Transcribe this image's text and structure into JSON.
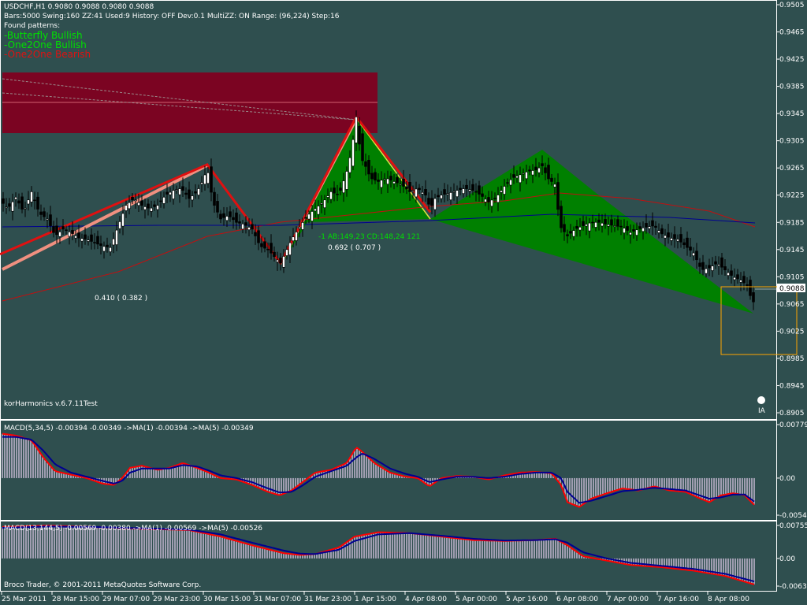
{
  "header": {
    "symbol_line": "USDCHF,H1  0.9080 0.9088 0.9080 0.9088",
    "params_line": "Bars:5000  Swing:160  ZZ:41  Used:9  History: OFF Dev:0.1  MultiZZ: ON  Range: (96,224)  Step:16",
    "found_label": "Found patterns:",
    "patterns": [
      {
        "text": "-Butterfly Bullish",
        "color": "#00e000"
      },
      {
        "text": "-One2One Bullish",
        "color": "#00e000"
      },
      {
        "text": "-One2One Bearish",
        "color": "#e01010"
      }
    ]
  },
  "footer": {
    "indicator_name": "korHarmonics v.6.7.11Test",
    "copyright": "Broco Trader, © 2001-2011 MetaQuotes Software Corp."
  },
  "colors": {
    "background": "#2F4F4F",
    "candle": "#000000",
    "green_pattern": "#008000",
    "red_zone": "#800020",
    "red_line": "#e01010",
    "pink_line": "#f09080",
    "macd_hist": "#dcc8e6",
    "signal_red": "#ff0000",
    "signal_blue": "#000090"
  },
  "chart_data": [
    {
      "type": "candlestick",
      "name": "USDCHF,H1",
      "price_axis_ticks": [
        "0.9505",
        "0.9465",
        "0.9425",
        "0.9385",
        "0.9345",
        "0.9305",
        "0.9265",
        "0.9225",
        "0.9185",
        "0.9145",
        "0.9105",
        "0.9065",
        "0.9025",
        "0.8985",
        "0.8945",
        "0.8905"
      ],
      "current_price": "0.9088",
      "time_axis_ticks": [
        "25 Mar 2011",
        "28 Mar 15:00",
        "29 Mar 07:00",
        "29 Mar 23:00",
        "30 Mar 15:00",
        "31 Mar 07:00",
        "31 Mar 23:00",
        "1 Apr 15:00",
        "4 Apr 08:00",
        "5 Apr 00:00",
        "5 Apr 16:00",
        "6 Apr 08:00",
        "7 Apr 00:00",
        "7 Apr 16:00",
        "8 Apr 08:00"
      ],
      "close_path": [
        [
          0,
          0.9218
        ],
        [
          10,
          0.9205
        ],
        [
          20,
          0.9222
        ],
        [
          30,
          0.92
        ],
        [
          40,
          0.923
        ],
        [
          50,
          0.9198
        ],
        [
          60,
          0.919
        ],
        [
          70,
          0.9165
        ],
        [
          80,
          0.9175
        ],
        [
          90,
          0.917
        ],
        [
          100,
          0.9162
        ],
        [
          110,
          0.916
        ],
        [
          120,
          0.9155
        ],
        [
          130,
          0.915
        ],
        [
          140,
          0.9148
        ],
        [
          150,
          0.918
        ],
        [
          160,
          0.921
        ],
        [
          170,
          0.922
        ],
        [
          180,
          0.921
        ],
        [
          190,
          0.9205
        ],
        [
          200,
          0.921
        ],
        [
          210,
          0.9225
        ],
        [
          220,
          0.9232
        ],
        [
          230,
          0.9235
        ],
        [
          240,
          0.922
        ],
        [
          250,
          0.923
        ],
        [
          258,
          0.9248
        ],
        [
          263,
          0.9265
        ],
        [
          270,
          0.9215
        ],
        [
          280,
          0.919
        ],
        [
          290,
          0.9195
        ],
        [
          300,
          0.9185
        ],
        [
          310,
          0.9182
        ],
        [
          320,
          0.9175
        ],
        [
          330,
          0.915
        ],
        [
          340,
          0.9145
        ],
        [
          350,
          0.9132
        ],
        [
          356,
          0.9125
        ],
        [
          362,
          0.914
        ],
        [
          370,
          0.916
        ],
        [
          380,
          0.9178
        ],
        [
          390,
          0.9195
        ],
        [
          400,
          0.9205
        ],
        [
          410,
          0.9215
        ],
        [
          420,
          0.923
        ],
        [
          430,
          0.9225
        ],
        [
          440,
          0.926
        ],
        [
          446,
          0.929
        ],
        [
          452,
          0.934
        ],
        [
          458,
          0.928
        ],
        [
          465,
          0.9265
        ],
        [
          470,
          0.925
        ],
        [
          480,
          0.9245
        ],
        [
          490,
          0.925
        ],
        [
          500,
          0.9245
        ],
        [
          510,
          0.924
        ],
        [
          520,
          0.923
        ],
        [
          530,
          0.9235
        ],
        [
          540,
          0.9225
        ],
        [
          546,
          0.9205
        ],
        [
          552,
          0.922
        ],
        [
          560,
          0.9225
        ],
        [
          570,
          0.9228
        ],
        [
          580,
          0.9232
        ],
        [
          590,
          0.9235
        ],
        [
          600,
          0.9232
        ],
        [
          610,
          0.9225
        ],
        [
          620,
          0.9215
        ],
        [
          630,
          0.9222
        ],
        [
          640,
          0.9238
        ],
        [
          650,
          0.925
        ],
        [
          660,
          0.9255
        ],
        [
          670,
          0.926
        ],
        [
          680,
          0.9262
        ],
        [
          688,
          0.9268
        ],
        [
          695,
          0.925
        ],
        [
          705,
          0.924
        ],
        [
          710,
          0.918
        ],
        [
          720,
          0.9165
        ],
        [
          730,
          0.9175
        ],
        [
          740,
          0.918
        ],
        [
          750,
          0.9185
        ],
        [
          760,
          0.9185
        ],
        [
          770,
          0.9182
        ],
        [
          780,
          0.918
        ],
        [
          790,
          0.9178
        ],
        [
          800,
          0.917
        ],
        [
          810,
          0.9175
        ],
        [
          820,
          0.9178
        ],
        [
          830,
          0.918
        ],
        [
          840,
          0.9168
        ],
        [
          850,
          0.9162
        ],
        [
          860,
          0.916
        ],
        [
          870,
          0.915
        ],
        [
          880,
          0.914
        ],
        [
          890,
          0.9115
        ],
        [
          900,
          0.9118
        ],
        [
          910,
          0.9125
        ],
        [
          920,
          0.9115
        ],
        [
          930,
          0.9105
        ],
        [
          940,
          0.91
        ],
        [
          950,
          0.909
        ],
        [
          955,
          0.9058
        ],
        [
          958,
          0.9088
        ]
      ],
      "zigzag": [
        [
          0,
          0.9138
        ],
        [
          263,
          0.927
        ],
        [
          356,
          0.9125
        ],
        [
          452,
          0.934
        ],
        [
          546,
          0.92
        ]
      ],
      "pattern_labels": [
        {
          "text": "-1   AB:149,23 CD:148,24   121",
          "color": "#00e000"
        },
        {
          "text": "0.692 ( 0.707 )",
          "color": "#ffffff"
        },
        {
          "text": "0.410 ( 0.382 )",
          "color": "#ffffff"
        }
      ]
    },
    {
      "type": "macd",
      "name": "MACD(5,34,5)",
      "label": "MACD(5,34,5) -0.00394 -0.00349  ->MA(1) -0.00394  ->MA(5) -0.00349",
      "y_ticks": [
        "0.00779",
        "0.00",
        "-0.0054"
      ],
      "ylim": [
        -0.0054,
        0.00779
      ],
      "hist_path": [
        [
          0,
          0.0065
        ],
        [
          20,
          0.0062
        ],
        [
          40,
          0.0055
        ],
        [
          55,
          0.003
        ],
        [
          70,
          0.001
        ],
        [
          90,
          0.0005
        ],
        [
          110,
          0.0
        ],
        [
          130,
          -0.0008
        ],
        [
          145,
          -0.001
        ],
        [
          155,
          0.0
        ],
        [
          165,
          0.0015
        ],
        [
          180,
          0.0018
        ],
        [
          200,
          0.0012
        ],
        [
          215,
          0.0015
        ],
        [
          232,
          0.0022
        ],
        [
          250,
          0.0015
        ],
        [
          265,
          0.0008
        ],
        [
          280,
          0.0
        ],
        [
          300,
          -0.0002
        ],
        [
          320,
          -0.001
        ],
        [
          340,
          -0.002
        ],
        [
          355,
          -0.0025
        ],
        [
          370,
          -0.0018
        ],
        [
          385,
          -0.0005
        ],
        [
          400,
          0.0008
        ],
        [
          420,
          0.0012
        ],
        [
          440,
          0.0022
        ],
        [
          452,
          0.0045
        ],
        [
          460,
          0.0038
        ],
        [
          475,
          0.0022
        ],
        [
          495,
          0.0008
        ],
        [
          515,
          0.0002
        ],
        [
          530,
          0.0
        ],
        [
          545,
          -0.0012
        ],
        [
          560,
          0.0
        ],
        [
          580,
          0.0003
        ],
        [
          600,
          0.0002
        ],
        [
          620,
          -0.0002
        ],
        [
          640,
          0.0004
        ],
        [
          660,
          0.0008
        ],
        [
          680,
          0.0009
        ],
        [
          700,
          0.0007
        ],
        [
          712,
          -0.001
        ],
        [
          720,
          -0.0035
        ],
        [
          735,
          -0.0042
        ],
        [
          750,
          -0.003
        ],
        [
          770,
          -0.0022
        ],
        [
          790,
          -0.0015
        ],
        [
          810,
          -0.0018
        ],
        [
          830,
          -0.0012
        ],
        [
          850,
          -0.0018
        ],
        [
          870,
          -0.002
        ],
        [
          885,
          -0.0028
        ],
        [
          900,
          -0.0035
        ],
        [
          915,
          -0.0025
        ],
        [
          930,
          -0.0022
        ],
        [
          945,
          -0.0025
        ],
        [
          958,
          -0.004
        ]
      ],
      "signal_path": [
        [
          0,
          0.006
        ],
        [
          20,
          0.006
        ],
        [
          40,
          0.0056
        ],
        [
          55,
          0.004
        ],
        [
          70,
          0.002
        ],
        [
          90,
          0.0008
        ],
        [
          110,
          0.0002
        ],
        [
          130,
          -0.0004
        ],
        [
          145,
          -0.0008
        ],
        [
          155,
          -0.0004
        ],
        [
          165,
          0.0008
        ],
        [
          180,
          0.0014
        ],
        [
          200,
          0.0014
        ],
        [
          215,
          0.0014
        ],
        [
          232,
          0.0019
        ],
        [
          250,
          0.0017
        ],
        [
          265,
          0.0011
        ],
        [
          280,
          0.0004
        ],
        [
          300,
          0.0
        ],
        [
          320,
          -0.0006
        ],
        [
          340,
          -0.0015
        ],
        [
          355,
          -0.0021
        ],
        [
          370,
          -0.002
        ],
        [
          385,
          -0.001
        ],
        [
          400,
          0.0002
        ],
        [
          420,
          0.001
        ],
        [
          440,
          0.0018
        ],
        [
          452,
          0.003
        ],
        [
          460,
          0.0036
        ],
        [
          475,
          0.0028
        ],
        [
          495,
          0.0014
        ],
        [
          515,
          0.0006
        ],
        [
          530,
          0.0002
        ],
        [
          545,
          -0.0006
        ],
        [
          560,
          -0.0002
        ],
        [
          580,
          0.0002
        ],
        [
          600,
          0.0002
        ],
        [
          620,
          0.0
        ],
        [
          640,
          0.0002
        ],
        [
          660,
          0.0006
        ],
        [
          680,
          0.0008
        ],
        [
          700,
          0.0008
        ],
        [
          712,
          0.0
        ],
        [
          720,
          -0.002
        ],
        [
          735,
          -0.0036
        ],
        [
          750,
          -0.0033
        ],
        [
          770,
          -0.0026
        ],
        [
          790,
          -0.0019
        ],
        [
          810,
          -0.0017
        ],
        [
          830,
          -0.0014
        ],
        [
          850,
          -0.0016
        ],
        [
          870,
          -0.0018
        ],
        [
          885,
          -0.0024
        ],
        [
          900,
          -0.003
        ],
        [
          915,
          -0.0028
        ],
        [
          930,
          -0.0024
        ],
        [
          945,
          -0.0024
        ],
        [
          958,
          -0.0035
        ]
      ]
    },
    {
      "type": "macd",
      "name": "MACD(13,144,5)",
      "label": "MACD(13,144,5) -0.00569 -0.00380  ->MA(1) -0.00569  ->MA(5) -0.00526",
      "y_ticks": [
        "0.00755",
        "0.00",
        "-0.00632"
      ],
      "ylim": [
        -0.00632,
        0.00755
      ],
      "hist_path": [
        [
          0,
          0.0072
        ],
        [
          60,
          0.0075
        ],
        [
          120,
          0.0072
        ],
        [
          180,
          0.0068
        ],
        [
          240,
          0.0065
        ],
        [
          280,
          0.005
        ],
        [
          320,
          0.003
        ],
        [
          360,
          0.0012
        ],
        [
          380,
          0.0008
        ],
        [
          400,
          0.001
        ],
        [
          430,
          0.0025
        ],
        [
          450,
          0.005
        ],
        [
          480,
          0.006
        ],
        [
          520,
          0.0058
        ],
        [
          560,
          0.005
        ],
        [
          600,
          0.0042
        ],
        [
          640,
          0.004
        ],
        [
          680,
          0.0042
        ],
        [
          705,
          0.0045
        ],
        [
          720,
          0.003
        ],
        [
          740,
          0.0005
        ],
        [
          770,
          -0.0005
        ],
        [
          800,
          -0.0015
        ],
        [
          840,
          -0.002
        ],
        [
          880,
          -0.0028
        ],
        [
          920,
          -0.004
        ],
        [
          958,
          -0.006
        ]
      ],
      "signal_path": [
        [
          0,
          0.007
        ],
        [
          60,
          0.0073
        ],
        [
          120,
          0.0072
        ],
        [
          180,
          0.0069
        ],
        [
          240,
          0.0066
        ],
        [
          280,
          0.0055
        ],
        [
          320,
          0.0036
        ],
        [
          360,
          0.0018
        ],
        [
          380,
          0.0011
        ],
        [
          400,
          0.001
        ],
        [
          430,
          0.002
        ],
        [
          450,
          0.004
        ],
        [
          480,
          0.0055
        ],
        [
          520,
          0.0058
        ],
        [
          560,
          0.0052
        ],
        [
          600,
          0.0045
        ],
        [
          640,
          0.0041
        ],
        [
          680,
          0.0042
        ],
        [
          705,
          0.0044
        ],
        [
          720,
          0.0036
        ],
        [
          740,
          0.0014
        ],
        [
          770,
          0.0
        ],
        [
          800,
          -0.001
        ],
        [
          840,
          -0.0017
        ],
        [
          880,
          -0.0024
        ],
        [
          920,
          -0.0035
        ],
        [
          958,
          -0.0053
        ]
      ]
    }
  ]
}
